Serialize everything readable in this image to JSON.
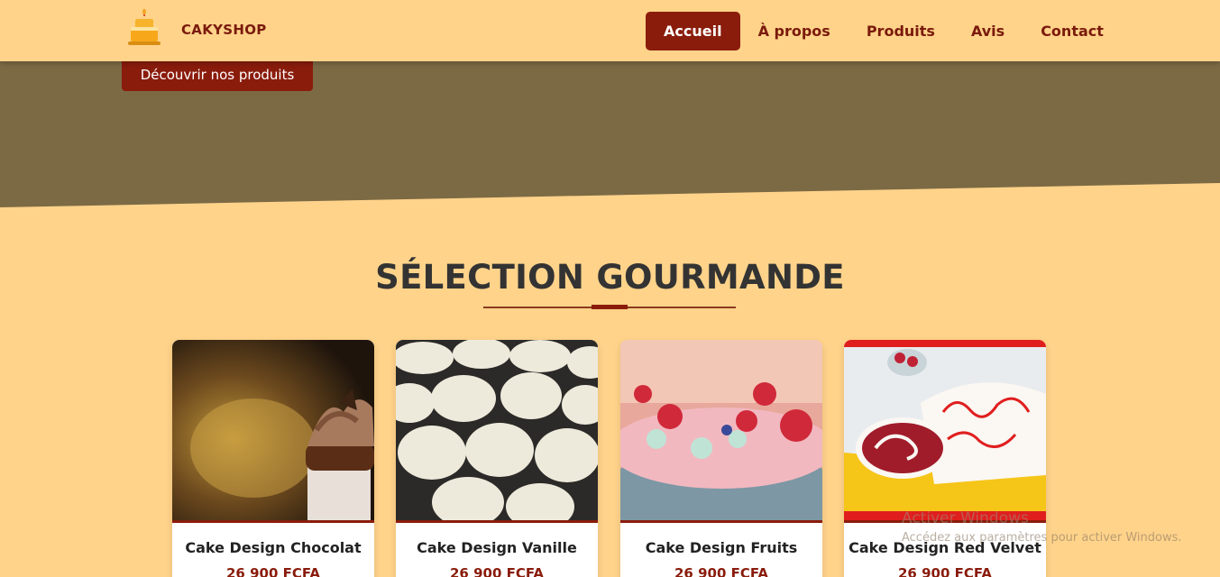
{
  "brand": {
    "name": "CAKYSHOP",
    "logo_icon": "cake-logo-icon"
  },
  "nav": {
    "items": [
      {
        "label": "Accueil",
        "active": true
      },
      {
        "label": "À propos",
        "active": false
      },
      {
        "label": "Produits",
        "active": false
      },
      {
        "label": "Avis",
        "active": false
      },
      {
        "label": "Contact",
        "active": false
      }
    ]
  },
  "hero": {
    "cta_label": "Découvrir nos produits"
  },
  "section": {
    "title": "SÉLECTION GOURMANDE"
  },
  "products": [
    {
      "name": "Cake Design Chocolat",
      "price": "26 900 FCFA",
      "image": "chocolate-cupcake-photo"
    },
    {
      "name": "Cake Design Vanille",
      "price": "26 900 FCFA",
      "image": "vanilla-cupcakes-photo"
    },
    {
      "name": "Cake Design Fruits",
      "price": "26 900 FCFA",
      "image": "fruit-cake-photo"
    },
    {
      "name": "Cake Design Red Velvet",
      "price": "26 900 FCFA",
      "image": "red-velvet-roll-photo"
    }
  ],
  "watermark": {
    "title": "Activer Windows",
    "subtitle": "Accédez aux paramètres pour activer Windows."
  },
  "colors": {
    "background": "#ffd38a",
    "hero": "#7c6a45",
    "accent": "#8a1c0c",
    "brand_text": "#7a1a0c"
  }
}
